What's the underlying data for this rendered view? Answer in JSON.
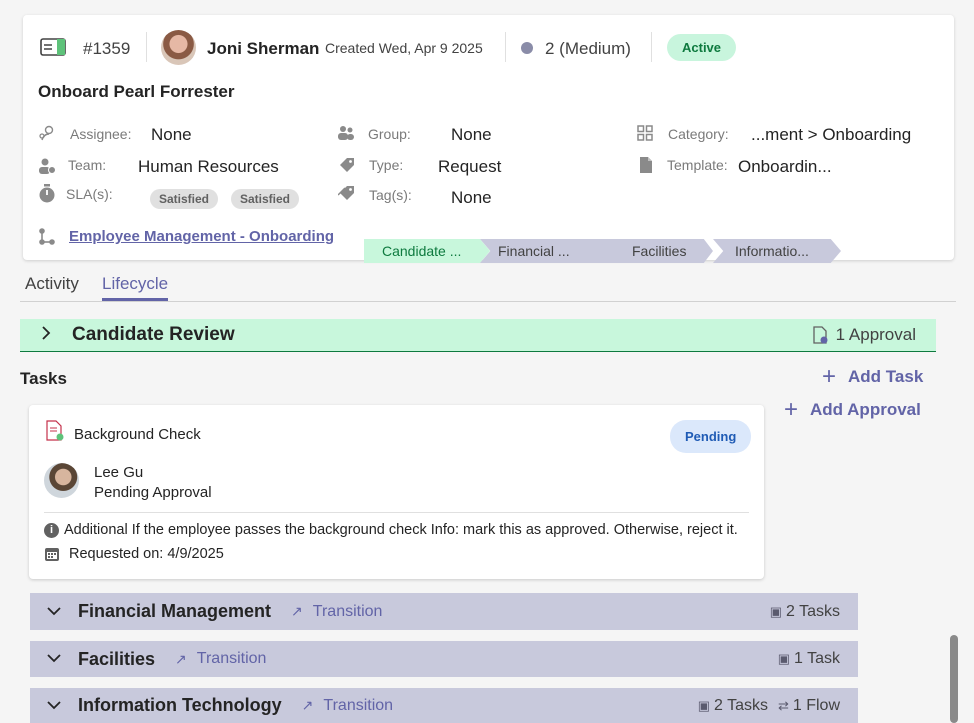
{
  "header": {
    "ticket_number": "#1359",
    "requester_name": "Joni Sherman",
    "created": "Created Wed, Apr 9 2025",
    "priority": "2 (Medium)",
    "status": "Active",
    "title": "Onboard Pearl Forrester"
  },
  "fields": {
    "assignee_label": "Assignee:",
    "assignee_value": "None",
    "group_label": "Group:",
    "group_value": "None",
    "category_label": "Category:",
    "category_value": "...ment > Onboarding",
    "team_label": "Team:",
    "team_value": "Human Resources",
    "type_label": "Type:",
    "type_value": "Request",
    "template_label": "Template:",
    "template_value": "Onboardin...",
    "sla_label": "SLA(s):",
    "sla_badges": [
      "Satisfied",
      "Satisfied"
    ],
    "tags_label": "Tag(s):",
    "tags_value": "None",
    "workflow_link": "Employee Management - Onboarding"
  },
  "stages": [
    "Candidate ...",
    "Financial ...",
    "Facilities",
    "Informatio..."
  ],
  "tabs": [
    "Activity",
    "Lifecycle"
  ],
  "active_tab": "Lifecycle",
  "current_stage": {
    "title": "Candidate Review",
    "approvals": "1 Approval"
  },
  "tasks": {
    "heading": "Tasks",
    "add_task": "Add Task",
    "add_approval": "Add Approval",
    "task": {
      "title": "Background Check",
      "status": "Pending",
      "assignee": "Lee Gu",
      "assignee_status": "Pending Approval",
      "info": "Additional If the employee passes the background check Info: mark this as approved. Otherwise, reject it.",
      "requested": "Requested on: 4/9/2025"
    }
  },
  "sections": [
    {
      "title": "Financial Management",
      "transition": "Transition",
      "tasks": "2 Tasks"
    },
    {
      "title": "Facilities",
      "transition": "Transition",
      "tasks": "1 Task"
    },
    {
      "title": "Information Technology",
      "transition": "Transition",
      "tasks": "2 Tasks",
      "flows": "1 Flow"
    }
  ],
  "colors": {
    "accent": "#6264a7",
    "active_badge_bg": "#c8f5dd",
    "active_badge_text": "#0e7a3f",
    "pending_badge_bg": "#dbe8fb",
    "pending_badge_text": "#1f5bb5",
    "stage_current": "#c8f7dc",
    "stage_other": "#c8c9dc",
    "section_bg": "#c8c9dc"
  },
  "icons": [
    "ticket-icon",
    "person-icon",
    "group-icon",
    "grid-icon",
    "team-icon",
    "tag-icon",
    "document-icon",
    "timer-icon",
    "tags-icon",
    "workflow-icon",
    "chevron-right-icon",
    "chevron-down-icon",
    "approval-icon",
    "plus-icon",
    "info-icon",
    "calendar-icon",
    "transition-icon",
    "tasks-icon",
    "flow-icon"
  ]
}
